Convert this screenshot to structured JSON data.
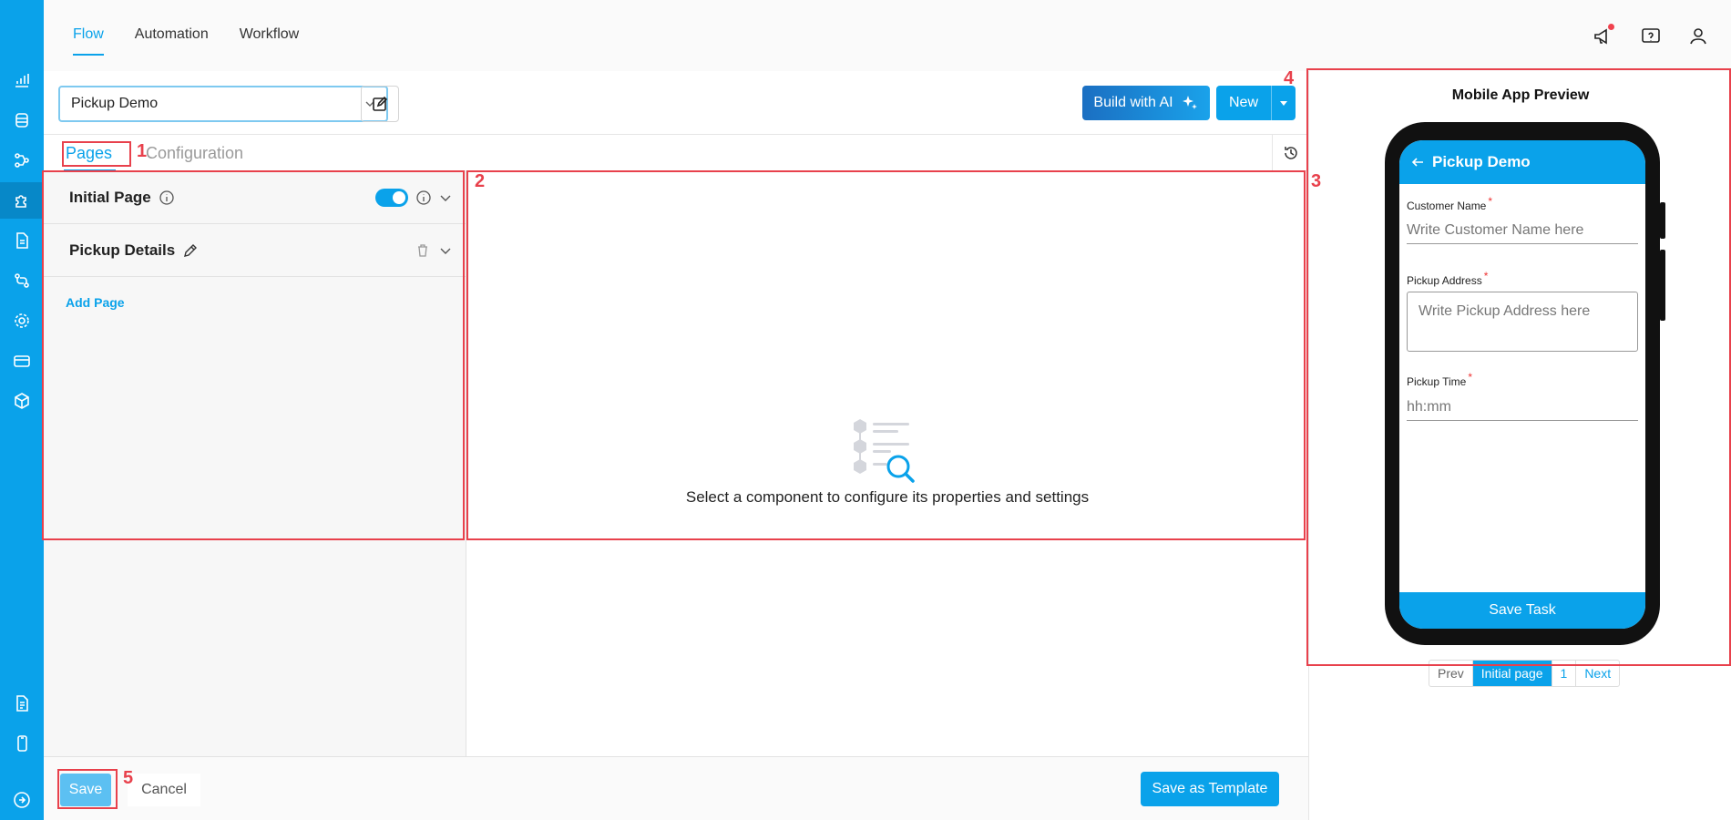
{
  "topnav": {
    "tabs": [
      "Flow",
      "Automation",
      "Workflow"
    ]
  },
  "toolbar": {
    "flow_selected": "Pickup Demo",
    "ai_button": "Build with AI",
    "new_button": "New"
  },
  "subtabs": {
    "pages": "Pages",
    "configuration": "Configuration"
  },
  "pages": [
    {
      "title": "Initial Page",
      "enabled": true
    },
    {
      "title": "Pickup Details"
    }
  ],
  "add_page": "Add Page",
  "center": {
    "empty_message": "Select a component to configure its properties and settings"
  },
  "bottom": {
    "save": "Save",
    "cancel": "Cancel",
    "save_template": "Save as Template"
  },
  "preview": {
    "title": "Mobile App Preview",
    "app_title": "Pickup Demo",
    "fields": [
      {
        "label": "Customer Name",
        "placeholder": "Write Customer Name here"
      },
      {
        "label": "Pickup Address",
        "placeholder": "Write Pickup Address here"
      },
      {
        "label": "Pickup Time",
        "placeholder": "hh:mm"
      }
    ],
    "required_mark": "*",
    "save_task": "Save Task",
    "pager": {
      "prev": "Prev",
      "current": "Initial page",
      "page_num": "1",
      "next": "Next"
    }
  },
  "annotations": [
    "1",
    "2",
    "3",
    "4",
    "5"
  ],
  "colors": {
    "accent": "#0aa2ea",
    "annotation": "#e8414c"
  }
}
